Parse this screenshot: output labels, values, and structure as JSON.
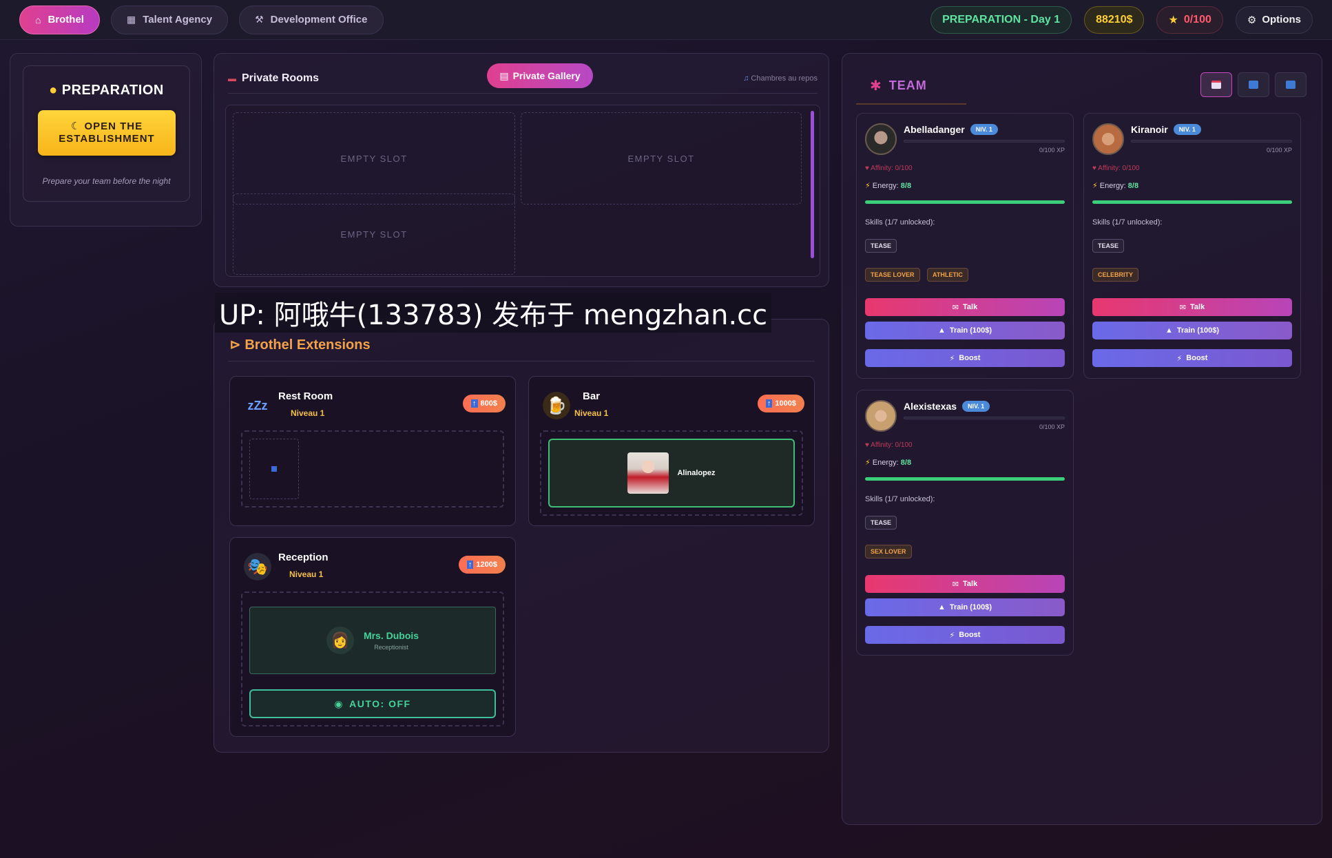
{
  "nav": {
    "tabs": [
      {
        "label": "Brothel",
        "icon": "house-icon"
      },
      {
        "label": "Talent Agency",
        "icon": "agency-icon"
      },
      {
        "label": "Development Office",
        "icon": "hammer-icon"
      }
    ],
    "phase": "PREPARATION - Day 1",
    "money": "88210$",
    "reputation": "0/100",
    "options": "Options"
  },
  "prep": {
    "title": "PREPARATION",
    "open_line1": "OPEN THE",
    "open_line2": "ESTABLISHMENT",
    "subtitle": "Prepare your team before the night"
  },
  "rooms": {
    "title": "Private Rooms",
    "gallery": "Private Gallery",
    "rest_label": "Chambres au repos",
    "slots": [
      "EMPTY SLOT",
      "EMPTY SLOT",
      "EMPTY SLOT"
    ]
  },
  "watermark": "UP: 阿哦牛(133783) 发布于 mengzhan.cc",
  "extensions": {
    "title": "Brothel Extensions",
    "rest": {
      "name": "Rest Room",
      "level": "Niveau 1",
      "price": "800$"
    },
    "bar": {
      "name": "Bar",
      "level": "Niveau 1",
      "price": "1000$",
      "girl": "Alinalopez"
    },
    "reception": {
      "name": "Reception",
      "level": "Niveau 1",
      "price": "1200$",
      "staff_name": "Mrs. Dubois",
      "staff_role": "Receptionist",
      "auto": "AUTO: OFF"
    }
  },
  "team": {
    "title": "TEAM",
    "girls": [
      {
        "name": "Abelladanger",
        "level": "NIV. 1",
        "xp": "0/100 XP",
        "affinity": "Affinity: 0/100",
        "energy_label": "Energy:",
        "energy": "8/8",
        "skills": "Skills (1/7 unlocked):",
        "skill_tags": [
          "TEASE"
        ],
        "traits": [
          "TEASE LOVER",
          "ATHLETIC"
        ],
        "talk": "Talk",
        "train": "Train (100$)",
        "boost": "Boost"
      },
      {
        "name": "Kiranoir",
        "level": "NIV. 1",
        "xp": "0/100 XP",
        "affinity": "Affinity: 0/100",
        "energy_label": "Energy:",
        "energy": "8/8",
        "skills": "Skills (1/7 unlocked):",
        "skill_tags": [
          "TEASE"
        ],
        "traits": [
          "CELEBRITY"
        ],
        "talk": "Talk",
        "train": "Train (100$)",
        "boost": "Boost"
      },
      {
        "name": "Alexistexas",
        "level": "NIV. 1",
        "xp": "0/100 XP",
        "affinity": "Affinity: 0/100",
        "energy_label": "Energy:",
        "energy": "8/8",
        "skills": "Skills (1/7 unlocked):",
        "skill_tags": [
          "TEASE"
        ],
        "traits": [
          "SEX LOVER"
        ],
        "talk": "Talk",
        "train": "Train (100$)",
        "boost": "Boost"
      }
    ]
  },
  "colors": {
    "accent": "#e0408f",
    "money": "#ffcf33",
    "phase": "#5fe3a0",
    "extensions": "#f2a34a"
  }
}
